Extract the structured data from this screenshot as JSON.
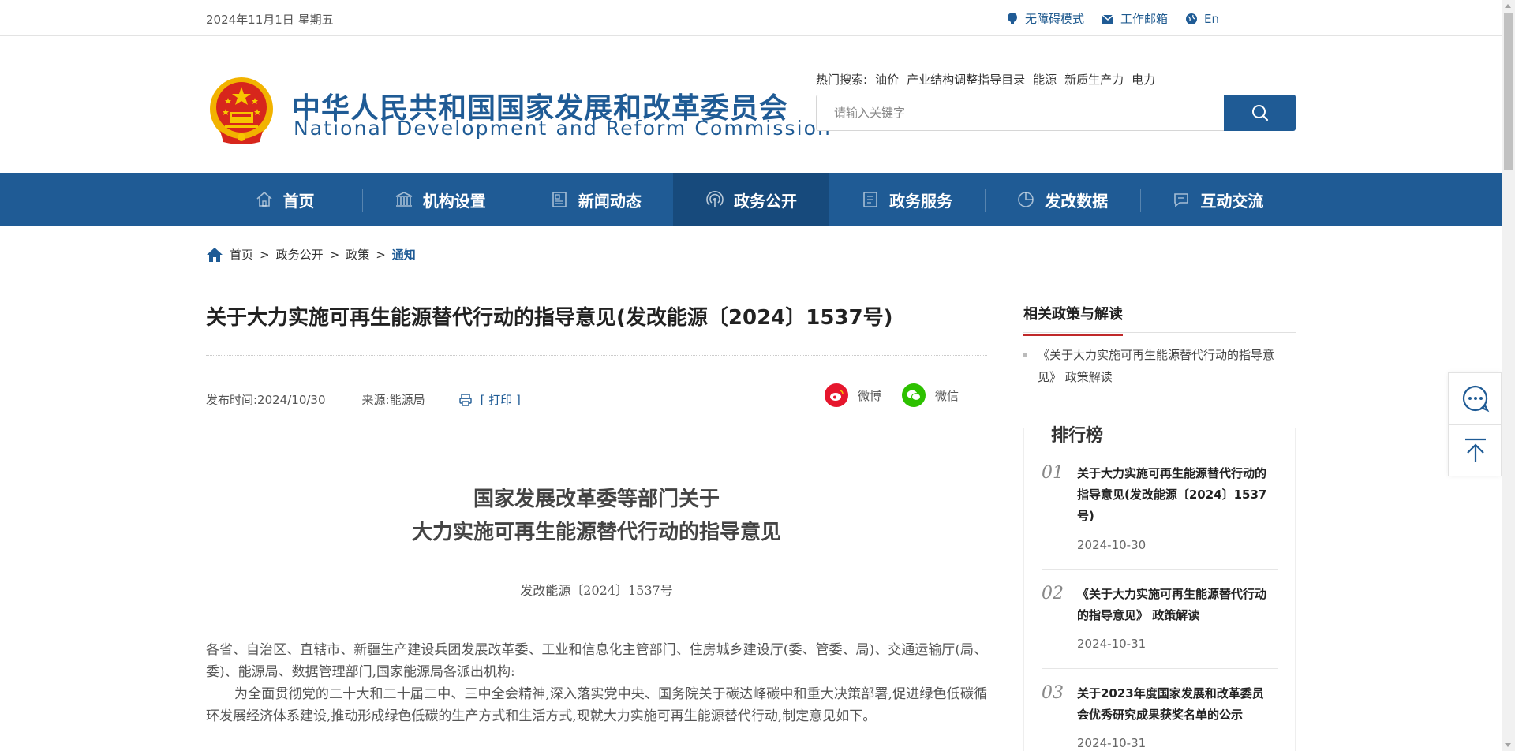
{
  "topbar": {
    "date": "2024年11月1日 星期五",
    "links": [
      {
        "label": "无障碍模式",
        "icon": "accessibility-icon"
      },
      {
        "label": "工作邮箱",
        "icon": "mail-icon"
      },
      {
        "label": "En",
        "icon": "globe-icon"
      }
    ]
  },
  "header": {
    "title_cn": "中华人民共和国国家发展和改革委员会",
    "title_en": "National Development and Reform Commission",
    "hot_label": "热门搜索:",
    "hot_keywords": [
      "油价",
      "产业结构调整指导目录",
      "能源",
      "新质生产力",
      "电力"
    ],
    "search_placeholder": "请输入关键字"
  },
  "nav": [
    {
      "label": "首页",
      "icon": "home-icon"
    },
    {
      "label": "机构设置",
      "icon": "building-icon"
    },
    {
      "label": "新闻动态",
      "icon": "news-icon"
    },
    {
      "label": "政务公开",
      "icon": "broadcast-icon",
      "active": true
    },
    {
      "label": "政务服务",
      "icon": "service-icon"
    },
    {
      "label": "发改数据",
      "icon": "pie-chart-icon"
    },
    {
      "label": "互动交流",
      "icon": "chat-icon"
    }
  ],
  "breadcrumb": {
    "items": [
      "首页",
      "政务公开",
      "政策"
    ],
    "current": "通知",
    "separator": ">"
  },
  "article": {
    "title": "关于大力实施可再生能源替代行动的指导意见(发改能源〔2024〕1537号)",
    "publish_time": "发布时间:2024/10/30",
    "source": "来源:能源局",
    "print_label": "[ 打印 ]",
    "share": [
      {
        "label": "微博",
        "icon": "weibo-icon",
        "color": "#e6162d"
      },
      {
        "label": "微信",
        "icon": "wechat-icon",
        "color": "#2dc100"
      }
    ],
    "doc_title_line1": "国家发展改革委等部门关于",
    "doc_title_line2": "大力实施可再生能源替代行动的指导意见",
    "doc_number": "发改能源〔2024〕1537号",
    "para1": "各省、自治区、直辖市、新疆生产建设兵团发展改革委、工业和信息化主管部门、住房城乡建设厅(委、管委、局)、交通运输厅(局、委)、能源局、数据管理部门,国家能源局各派出机构:",
    "para2": "为全面贯彻党的二十大和二十届二中、三中全会精神,深入落实党中央、国务院关于碳达峰碳中和重大决策部署,促进绿色低碳循环发展经济体系建设,推动形成绿色低碳的生产方式和生活方式,现就大力实施可再生能源替代行动,制定意见如下。"
  },
  "sidebar": {
    "related_title": "相关政策与解读",
    "related_item": "《关于大力实施可再生能源替代行动的指导意见》 政策解读",
    "rank_title": "排行榜",
    "rank": [
      {
        "num": "01",
        "title": "关于大力实施可再生能源替代行动的指导意见(发改能源〔2024〕1537号)",
        "date": "2024-10-30"
      },
      {
        "num": "02",
        "title": "《关于大力实施可再生能源替代行动的指导意见》 政策解读",
        "date": "2024-10-31"
      },
      {
        "num": "03",
        "title": "关于2023年度国家发展和改革委员会优秀研究成果获奖名单的公示",
        "date": "2024-10-31"
      }
    ]
  },
  "colors": {
    "brand_blue": "#1f5b95",
    "active_nav": "#174a7c",
    "accent_red": "#c0292a"
  }
}
